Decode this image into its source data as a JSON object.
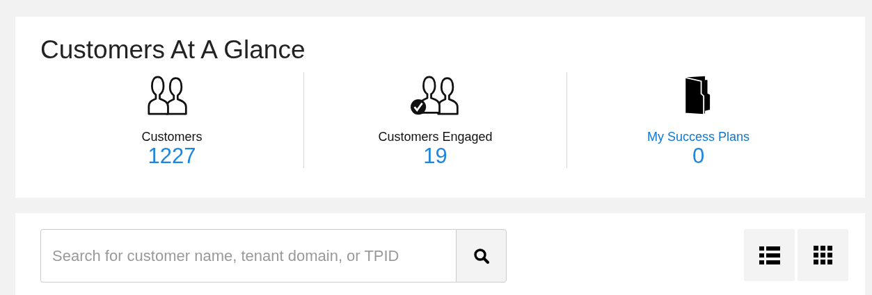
{
  "title": "Customers At A Glance",
  "stats": [
    {
      "kind": "count",
      "label": "Customers",
      "value": "1227"
    },
    {
      "kind": "count",
      "label": "Customers Engaged",
      "value": "19"
    },
    {
      "kind": "link",
      "label": "My Success Plans",
      "value": "0"
    }
  ],
  "search": {
    "placeholder": "Search for customer name, tenant domain, or TPID"
  }
}
